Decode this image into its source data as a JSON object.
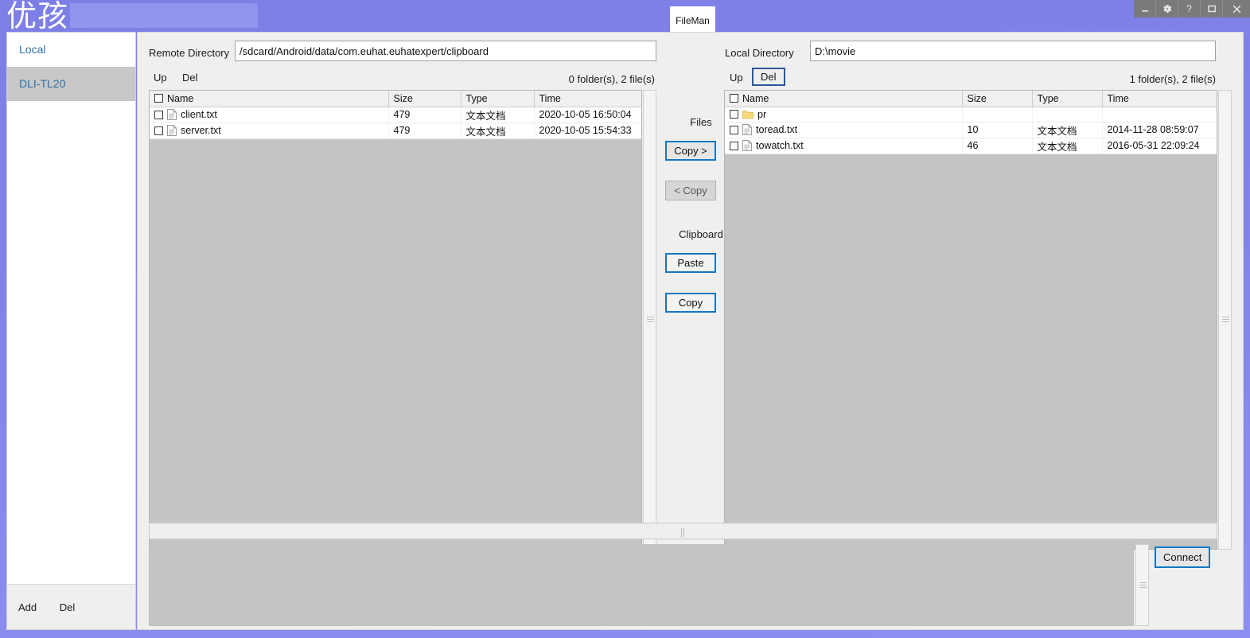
{
  "window": {
    "logo": "优孩",
    "tabs": [
      {
        "label": "FileMan"
      }
    ],
    "controls": [
      {
        "name": "minimize-button",
        "glyph": "—"
      },
      {
        "name": "settings-button",
        "glyph": "gear"
      },
      {
        "name": "help-button",
        "glyph": "?"
      },
      {
        "name": "maximize-button",
        "glyph": "□"
      },
      {
        "name": "close-button",
        "glyph": "✕"
      }
    ]
  },
  "sidebar": {
    "header": "Local",
    "items": [
      {
        "label": "DLI-TL20",
        "selected": true
      }
    ],
    "footer": {
      "add": "Add",
      "del": "Del"
    }
  },
  "remote": {
    "label": "Remote Directory",
    "path": "/sdcard/Android/data/com.euhat.euhatexpert/clipboard",
    "up": "Up",
    "del": "Del",
    "count": "0 folder(s), 2 file(s)",
    "columns": [
      "Name",
      "Size",
      "Type",
      "Time"
    ],
    "rows": [
      {
        "icon": "file-icon",
        "name": "client.txt",
        "size": "479",
        "type": "文本文档",
        "time": "2020-10-05 16:50:04"
      },
      {
        "icon": "file-icon",
        "name": "server.txt",
        "size": "479",
        "type": "文本文档",
        "time": "2020-10-05 15:54:33"
      }
    ]
  },
  "local": {
    "label": "Local Directory",
    "path": "D:\\movie",
    "up": "Up",
    "del": "Del",
    "count": "1 folder(s), 2 file(s)",
    "columns": [
      "Name",
      "Size",
      "Type",
      "Time"
    ],
    "rows": [
      {
        "icon": "folder-icon",
        "name": "pr",
        "size": "",
        "type": "",
        "time": ""
      },
      {
        "icon": "file-icon",
        "name": "toread.txt",
        "size": "10",
        "type": "文本文档",
        "time": "2014-11-28 08:59:07"
      },
      {
        "icon": "file-icon",
        "name": "towatch.txt",
        "size": "46",
        "type": "文本文档",
        "time": "2016-05-31 22:09:24"
      }
    ]
  },
  "middle": {
    "files_label": "Files",
    "copy_right": "Copy >",
    "copy_left": "< Copy",
    "clipboard_label": "Clipboard",
    "paste": "Paste",
    "copy": "Copy"
  },
  "bottom": {
    "connect": "Connect",
    "log_text": ""
  },
  "colors": {
    "brand_purple": "#8183e8",
    "accent_blue": "#1277c0",
    "focus_blue": "#2b5797",
    "sidebar_link": "#2f6fa8",
    "folder_yellow": "#f7d777"
  }
}
